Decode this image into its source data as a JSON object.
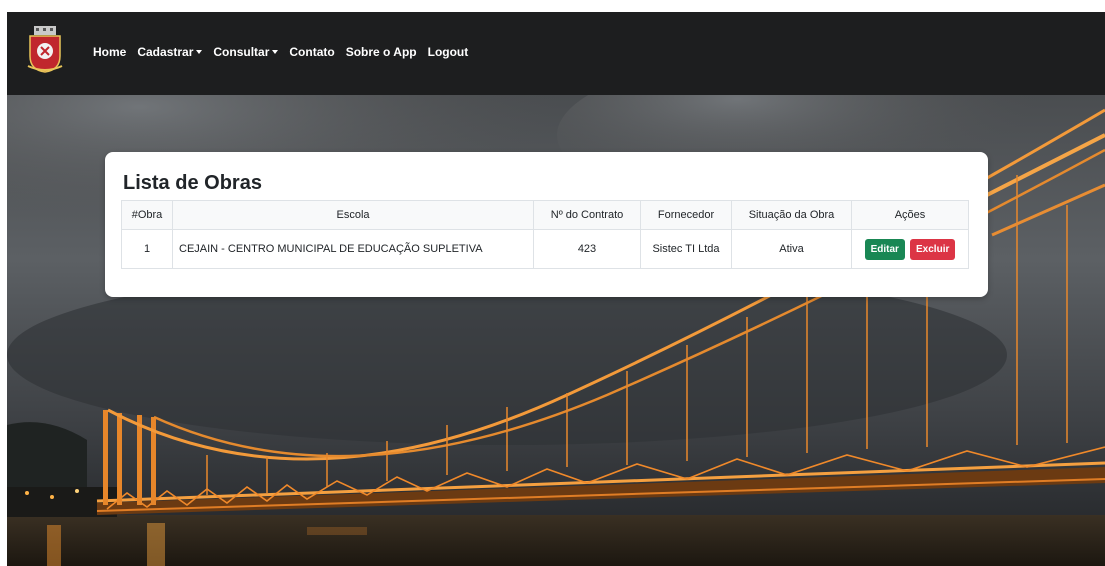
{
  "nav": {
    "items": [
      {
        "label": "Home",
        "dropdown": false
      },
      {
        "label": "Cadastrar",
        "dropdown": true
      },
      {
        "label": "Consultar",
        "dropdown": true
      },
      {
        "label": "Contato",
        "dropdown": false
      },
      {
        "label": "Sobre o App",
        "dropdown": false
      },
      {
        "label": "Logout",
        "dropdown": false
      }
    ]
  },
  "card": {
    "title": "Lista de Obras",
    "table": {
      "headers": [
        "#Obra",
        "Escola",
        "Nº do Contrato",
        "Fornecedor",
        "Situação da Obra",
        "Ações"
      ],
      "rows": [
        {
          "obra": "1",
          "escola": "CEJAIN - CENTRO MUNICIPAL DE EDUCAÇÃO SUPLETIVA",
          "contrato": "423",
          "fornecedor": "Sistec TI Ltda",
          "situacao": "Ativa",
          "edit_label": "Editar",
          "delete_label": "Excluir"
        }
      ]
    }
  },
  "colors": {
    "navbar": "#1d1e1f",
    "edit_button": "#198754",
    "delete_button": "#dc3545",
    "bridge_light": "#f0892a"
  }
}
